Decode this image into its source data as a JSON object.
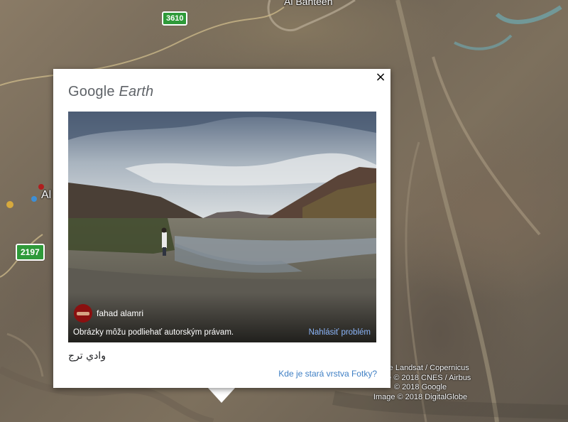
{
  "map": {
    "road_shields": [
      "3610",
      "2197"
    ],
    "place_labels": [
      "Al Bahteen",
      "Al"
    ],
    "attribution_lines": [
      "Image Landsat / Copernicus",
      "Image © 2018 CNES / Airbus",
      "© 2018 Google",
      "Image © 2018 DigitalGlobe"
    ]
  },
  "card": {
    "logo_google": "Google",
    "logo_earth": "Earth",
    "close_icon": "×",
    "photo": {
      "author_name": "fahad alamri",
      "copyright_note": "Obrázky môžu podliehať autorským právam.",
      "report_link": "Nahlásiť problém"
    },
    "caption": "وادي ترج",
    "old_layer_link": "Kde je stará vrstva Fotky?"
  },
  "colors": {
    "link_blue": "#3f7fc4",
    "report_link": "#8ab4f8",
    "shield_green": "#2e9a3a"
  }
}
